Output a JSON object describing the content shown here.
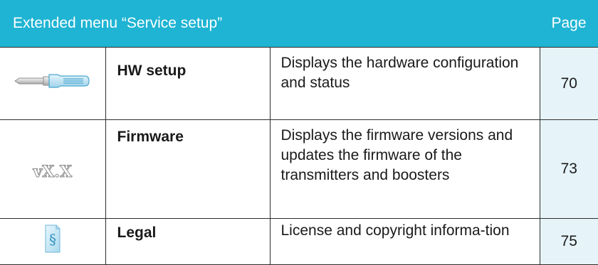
{
  "header": {
    "title": "Extended menu “Service setup”",
    "page_label": "Page"
  },
  "rows": [
    {
      "icon": "service-tool-icon",
      "name": "HW setup",
      "description": "Displays the hardware configuration and status",
      "page": "70"
    },
    {
      "icon": "firmware-version-icon",
      "icon_text": "vX.X",
      "name": "Firmware",
      "description": "Displays the firmware versions and updates the firmware of the transmitters and boosters",
      "page": "73"
    },
    {
      "icon": "legal-document-icon",
      "name": "Legal",
      "description": "License and copyright informa-tion",
      "page": "75"
    }
  ],
  "colors": {
    "header_bg": "#1fb4d3",
    "page_cell_bg": "#e6f4f9",
    "border": "#2c2c2c"
  }
}
